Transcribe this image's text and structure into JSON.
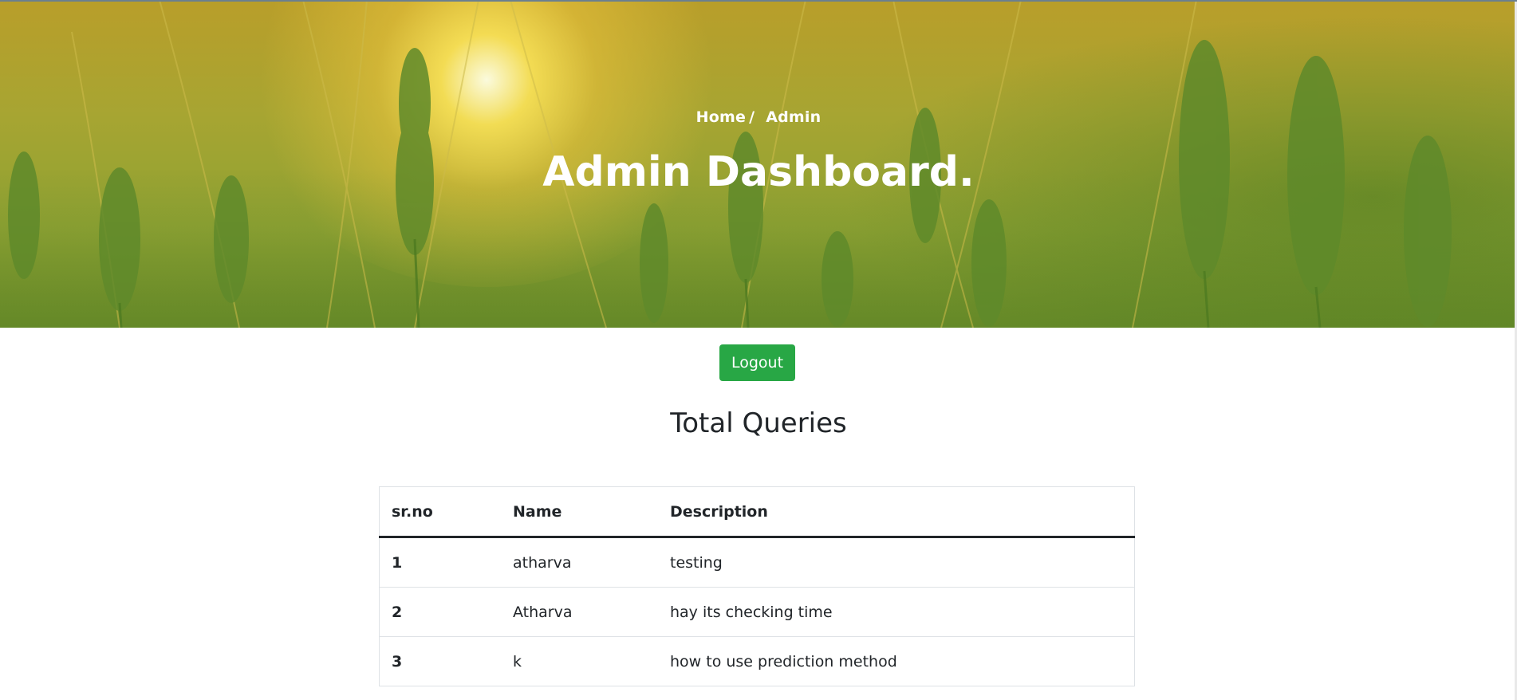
{
  "hero": {
    "breadcrumb_home": "Home",
    "breadcrumb_separator": "/",
    "breadcrumb_current": "Admin",
    "title": "Admin Dashboard."
  },
  "actions": {
    "logout_label": "Logout"
  },
  "queries": {
    "heading": "Total Queries",
    "columns": [
      "sr.no",
      "Name",
      "Description"
    ],
    "rows": [
      {
        "sr": "1",
        "name": "atharva",
        "description": "testing"
      },
      {
        "sr": "2",
        "name": "Atharva",
        "description": "hay its checking time"
      },
      {
        "sr": "3",
        "name": "k",
        "description": "how to use prediction method"
      }
    ]
  },
  "colors": {
    "button": "#28a745",
    "text": "#212529",
    "hero_text": "#ffffff"
  }
}
